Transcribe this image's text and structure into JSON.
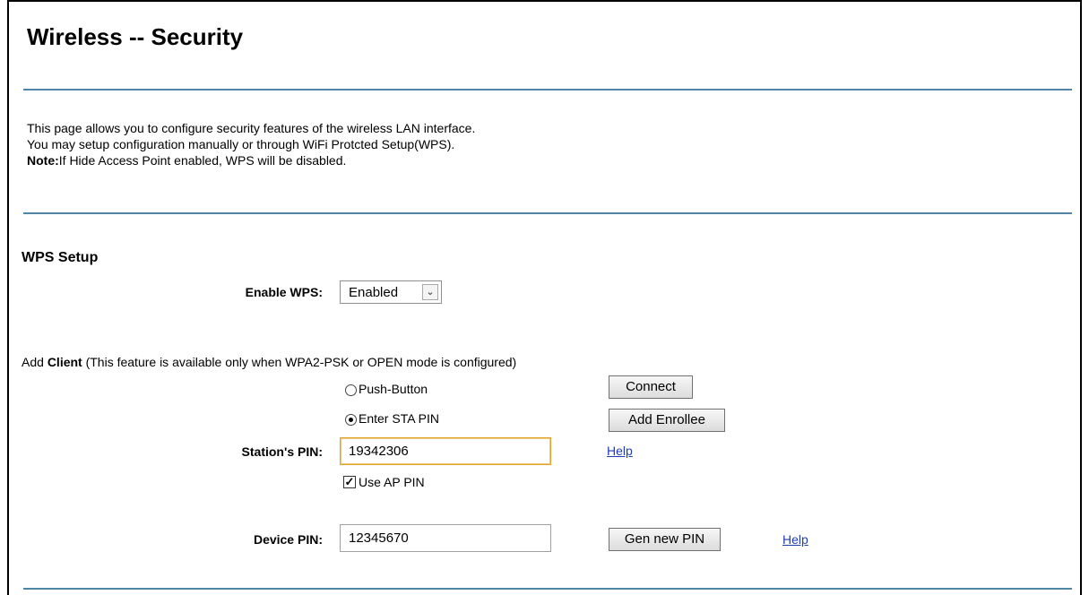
{
  "page": {
    "title": "Wireless -- Security",
    "intro_line1": "This page allows you to configure security features of the wireless LAN interface.",
    "intro_line2": "You may setup configuration manually or through WiFi Protcted Setup(WPS).",
    "note_label": "Note:",
    "note_text": "If Hide Access Point enabled, WPS will be disabled."
  },
  "wps": {
    "section_title": "WPS Setup",
    "enable_label": "Enable WPS:",
    "enable_value": "Enabled"
  },
  "client": {
    "prefix": "Add ",
    "bold": "Client",
    "suffix": " (This feature is available only when WPA2-PSK or OPEN mode is configured)",
    "push_button_label": "Push-Button",
    "connect_button": "Connect",
    "enter_sta_pin_label": "Enter STA PIN",
    "add_enrollee_button": "Add Enrollee",
    "station_pin_label": "Station's PIN:",
    "station_pin_value": "19342306",
    "help_link": "Help",
    "use_ap_pin_label": "Use AP PIN",
    "use_ap_pin_checked": true,
    "selected_mode": "Enter STA PIN"
  },
  "device": {
    "device_pin_label": "Device PIN:",
    "device_pin_value": "12345670",
    "gen_new_pin_button": "Gen new PIN",
    "help_link": "Help"
  },
  "colors": {
    "rule": "#4f86a8",
    "link": "#1f3eb3",
    "focus_border": "#e2a32c"
  },
  "icons": {
    "select_arrow": "chevron-down-icon",
    "checkbox": "check-icon"
  }
}
